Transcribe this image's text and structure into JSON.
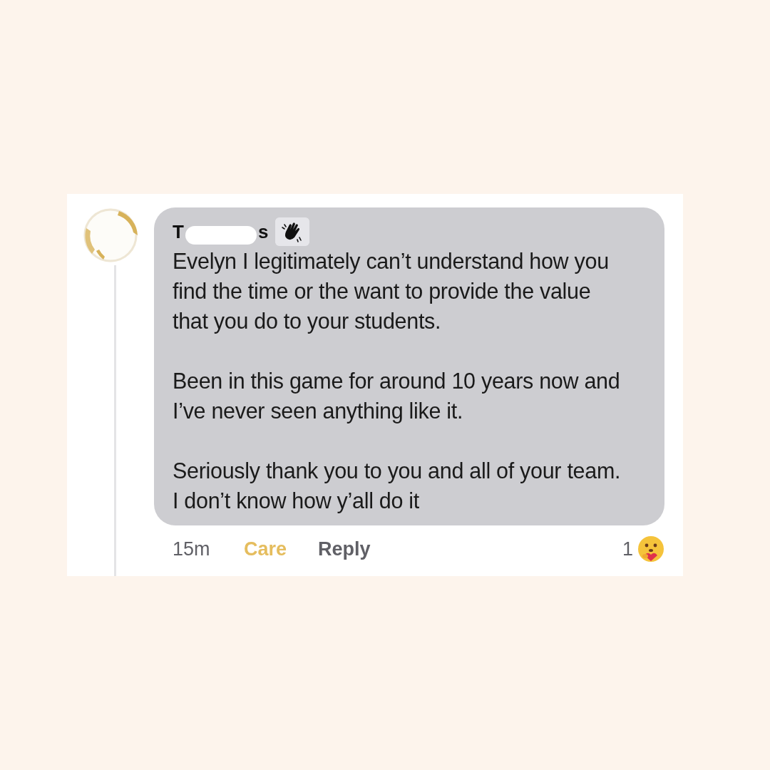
{
  "comment": {
    "author": {
      "name_start": "T",
      "name_end": "s",
      "redacted": true
    },
    "paragraphs": [
      "Evelyn I legitimately can’t understand how you find the time or the want to provide the value that you do to your students.",
      "Been in this game for around 10 years now and I’ve never seen anything like it.",
      "Seriously thank you to you and all of your team. I don’t know how y’all do it"
    ],
    "time": "15m",
    "reaction": {
      "label": "Care",
      "selected": true
    },
    "reply": "Reply",
    "reaction_count": "1"
  }
}
